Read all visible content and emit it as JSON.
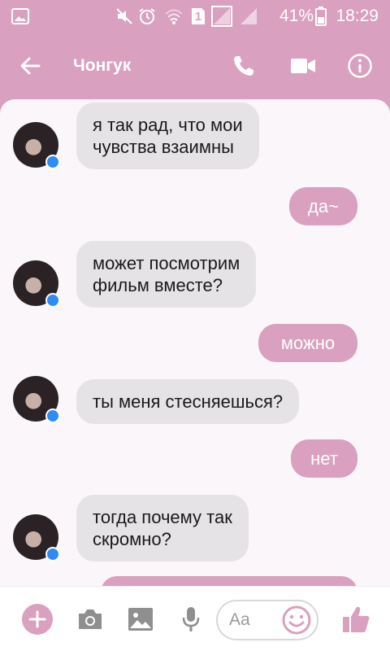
{
  "status_bar": {
    "time": "18:29",
    "battery_percent": "41%",
    "sim_number": "1",
    "icons": [
      "gallery-icon",
      "muted-icon",
      "alarm-icon",
      "wifi-icon",
      "sim-icon",
      "signal-icon",
      "signal-icon",
      "battery-icon"
    ]
  },
  "header": {
    "title": "Чонгук",
    "icons": [
      "back-arrow-icon",
      "phone-icon",
      "video-camera-icon",
      "info-icon"
    ]
  },
  "messages": [
    {
      "dir": "in",
      "text_lines": [
        "я так рад, что мои",
        "чувства взаимны"
      ]
    },
    {
      "dir": "out",
      "text": "да~"
    },
    {
      "dir": "in",
      "text_lines": [
        "может посмотрим",
        "фильм вместе?"
      ]
    },
    {
      "dir": "out",
      "text": "можно"
    },
    {
      "dir": "in",
      "text": "ты меня стесняешься?"
    },
    {
      "dir": "out",
      "text": "нет"
    },
    {
      "dir": "in",
      "text_lines": [
        "тогда почему так",
        "скромно?"
      ]
    }
  ],
  "composer": {
    "placeholder": "Aa",
    "icons": [
      "plus-icon",
      "camera-icon",
      "image-icon",
      "microphone-icon",
      "emoji-icon",
      "thumbs-up-icon"
    ]
  },
  "colors": {
    "accent": "#d9a0bf",
    "incoming_bubble": "#e6e3e6",
    "outgoing_bubble": "#d9a0bf",
    "background": "#faf6fa",
    "messenger_badge": "#2e8cf7"
  }
}
